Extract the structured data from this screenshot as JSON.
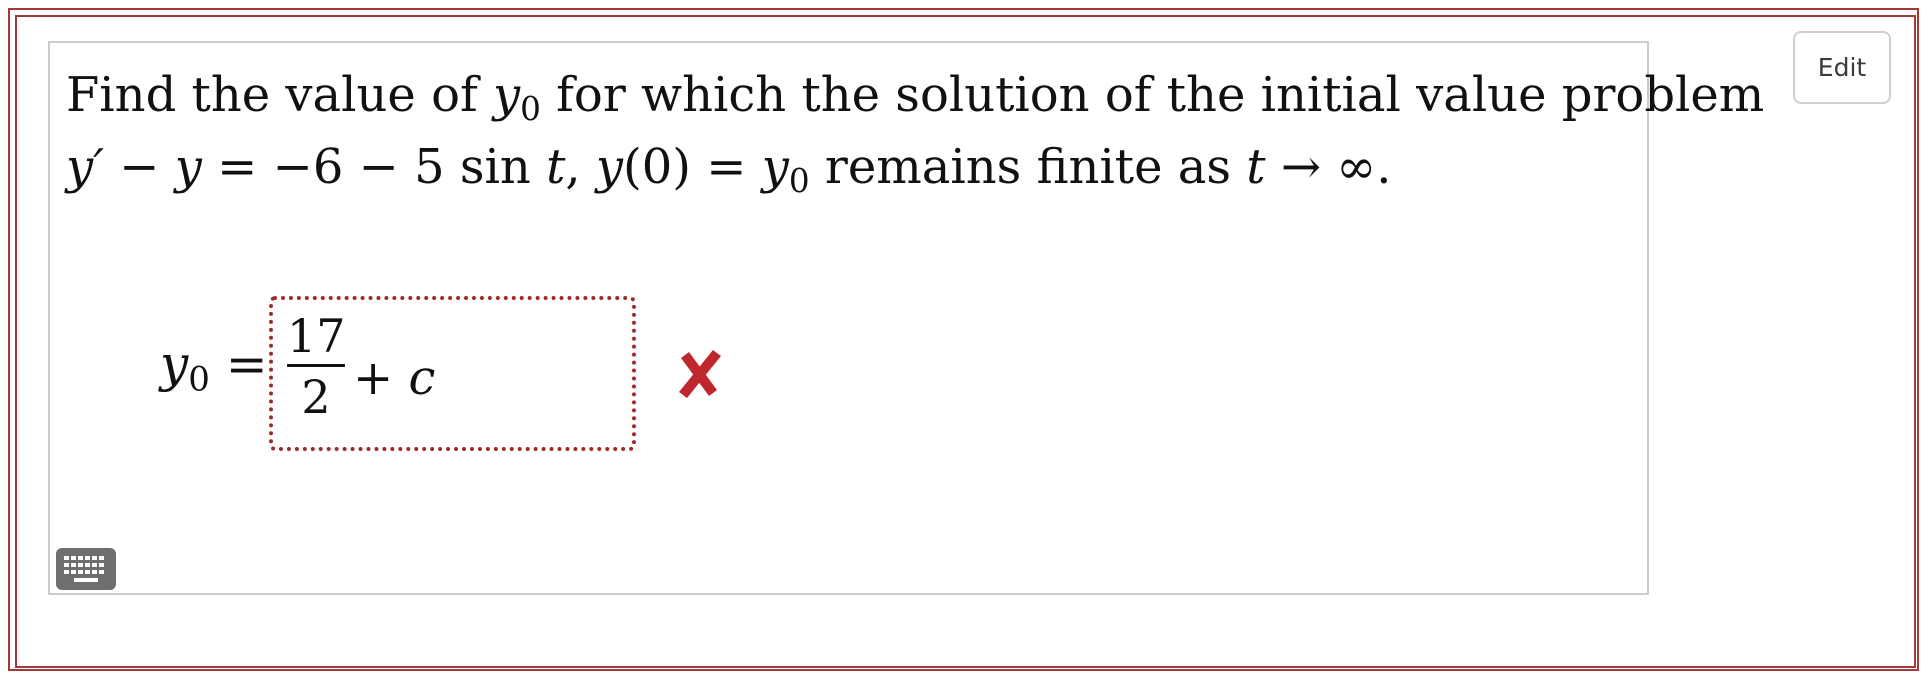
{
  "edit_button": {
    "label": "Edit"
  },
  "question": {
    "line1": {
      "before": "Find the value of ",
      "var": "y",
      "sub": "0",
      "after": " for which the solution of the initial value problem"
    },
    "line2": {
      "eq_lhs": "y′ − y",
      "eq_rhs": " = −6 − 5 sin ",
      "t1": "t",
      "comma": ", ",
      "ic_fn": "y",
      "ic_arg": "(0) = ",
      "ic_var": "y",
      "ic_sub": "0",
      "text": " remains finite as ",
      "t2": "t",
      "limit": " → ∞."
    }
  },
  "answer": {
    "label_var": "y",
    "label_sub": "0",
    "label_eq": " =",
    "numerator": "17",
    "denominator": "2",
    "plus": "+ ",
    "const": "c",
    "status": "incorrect",
    "status_icon": "x-mark-icon"
  },
  "colors": {
    "frame": "#a33a3a",
    "answer_border": "#9e2a2a",
    "wrong_mark": "#c0272d",
    "keyboard_button": "#6f6f6f"
  },
  "keyboard_icon": "keyboard-icon"
}
